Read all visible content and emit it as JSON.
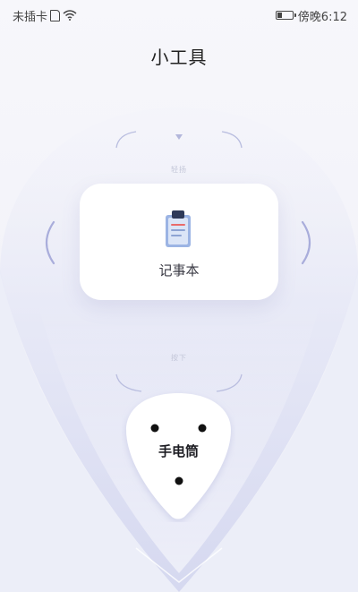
{
  "status_bar": {
    "carrier": "未插卡",
    "time": "傍晚6:12",
    "sim_icon": "sim-card-icon",
    "wifi_icon": "wifi-icon",
    "battery_icon": "battery-icon"
  },
  "header": {
    "title": "小工具"
  },
  "carousel": {
    "top_hint": "轻扬",
    "bottom_hint": "按下",
    "current_tool": {
      "label": "记事本",
      "icon": "notebook-icon"
    },
    "left_arrow_icon": "chevron-left-icon",
    "right_arrow_icon": "chevron-right-icon"
  },
  "flashlight": {
    "label": "手电筒"
  },
  "colors": {
    "background": "#f3f3f9",
    "accent": "#a7abd8",
    "shield": "#dfe1f3",
    "card": "#ffffff"
  }
}
